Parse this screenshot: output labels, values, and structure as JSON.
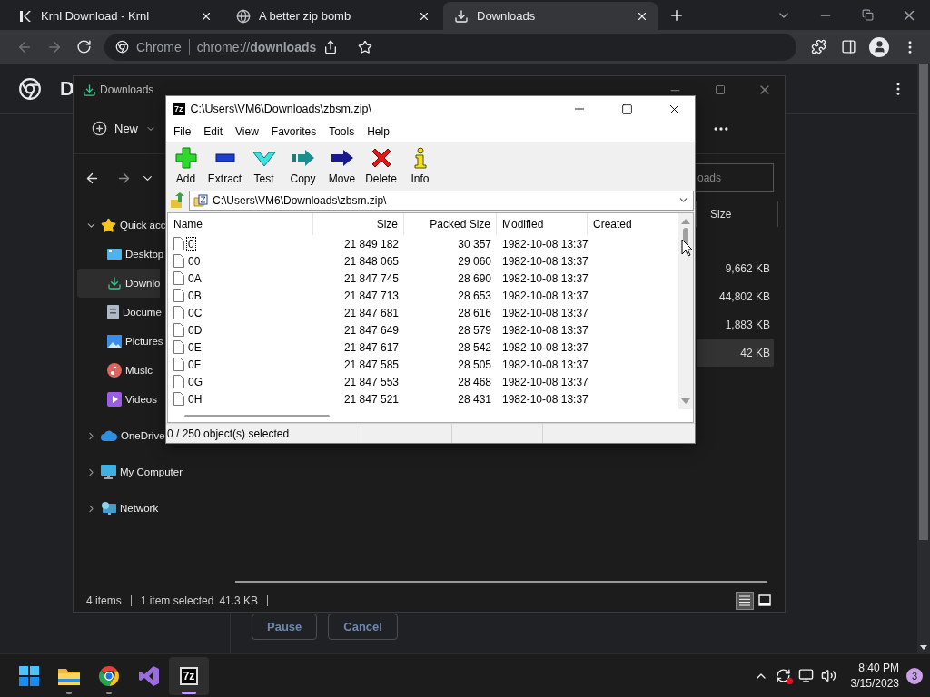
{
  "browser": {
    "tabs": [
      {
        "title": "Krnl Download - Krnl",
        "selected": false
      },
      {
        "title": "A better zip bomb",
        "selected": false
      },
      {
        "title": "Downloads",
        "selected": true
      }
    ],
    "back": {
      "disabled": true
    },
    "forward": {
      "disabled": true
    },
    "omnibox": {
      "site": "Chrome",
      "url": "chrome://**downloads**"
    },
    "page": {
      "title": "D",
      "buttons": [
        "Pause",
        "Cancel"
      ]
    }
  },
  "explorer": {
    "title": "Downloads",
    "new_button": "New",
    "search": {
      "placeholder": "oads"
    },
    "nav_tree": [
      {
        "label": "Quick acc",
        "expanded": true,
        "selected": false,
        "children": [
          {
            "label": "Desktop",
            "selected": false
          },
          {
            "label": "Downlo",
            "selected": true
          },
          {
            "label": "Docume",
            "selected": false
          },
          {
            "label": "Pictures",
            "selected": false
          },
          {
            "label": "Music",
            "selected": false
          },
          {
            "label": "Videos",
            "selected": false
          }
        ]
      },
      {
        "label": "OneDrive",
        "expanded": false,
        "selected": false
      },
      {
        "label": "My Computer",
        "expanded": false,
        "selected": false
      },
      {
        "label": "Network",
        "expanded": false,
        "selected": false
      }
    ],
    "size_column": "Size",
    "files": [
      {
        "size": "9,662 KB",
        "selected": false
      },
      {
        "size": "44,802 KB",
        "selected": false
      },
      {
        "size": "1,883 KB",
        "selected": false
      },
      {
        "size": "42 KB",
        "selected": true
      }
    ],
    "status": {
      "items": "4 items",
      "selection": "1 item selected",
      "selection_size": "41.3 KB"
    },
    "views": [
      {
        "kind": "details",
        "selected": true
      },
      {
        "kind": "tiles",
        "selected": false
      }
    ]
  },
  "sevenzip": {
    "icon_text": "7z",
    "title": "C:\\Users\\VM6\\Downloads\\zbsm.zip\\",
    "menu": [
      "File",
      "Edit",
      "View",
      "Favorites",
      "Tools",
      "Help"
    ],
    "toolbar": [
      {
        "kind": "add",
        "label": "Add"
      },
      {
        "kind": "extract",
        "label": "Extract"
      },
      {
        "kind": "test",
        "label": "Test"
      },
      {
        "kind": "copy",
        "label": "Copy"
      },
      {
        "kind": "move",
        "label": "Move"
      },
      {
        "kind": "delete",
        "label": "Delete"
      },
      {
        "kind": "info",
        "label": "Info"
      }
    ],
    "path": "C:\\Users\\VM6\\Downloads\\zbsm.zip\\",
    "columns": [
      "Name",
      "Size",
      "Packed Size",
      "Modified",
      "Created"
    ],
    "rows": [
      {
        "name": "0",
        "size": "21 849 182",
        "packed_size": "30 357",
        "modified": "1982-10-08 13:37",
        "focused": true
      },
      {
        "name": "00",
        "size": "21 848 065",
        "packed_size": "29 060",
        "modified": "1982-10-08 13:37",
        "focused": false
      },
      {
        "name": "0A",
        "size": "21 847 745",
        "packed_size": "28 690",
        "modified": "1982-10-08 13:37",
        "focused": false
      },
      {
        "name": "0B",
        "size": "21 847 713",
        "packed_size": "28 653",
        "modified": "1982-10-08 13:37",
        "focused": false
      },
      {
        "name": "0C",
        "size": "21 847 681",
        "packed_size": "28 616",
        "modified": "1982-10-08 13:37",
        "focused": false
      },
      {
        "name": "0D",
        "size": "21 847 649",
        "packed_size": "28 579",
        "modified": "1982-10-08 13:37",
        "focused": false
      },
      {
        "name": "0E",
        "size": "21 847 617",
        "packed_size": "28 542",
        "modified": "1982-10-08 13:37",
        "focused": false
      },
      {
        "name": "0F",
        "size": "21 847 585",
        "packed_size": "28 505",
        "modified": "1982-10-08 13:37",
        "focused": false
      },
      {
        "name": "0G",
        "size": "21 847 553",
        "packed_size": "28 468",
        "modified": "1982-10-08 13:37",
        "focused": false
      },
      {
        "name": "0H",
        "size": "21 847 521",
        "packed_size": "28 431",
        "modified": "1982-10-08 13:37",
        "focused": false
      }
    ],
    "status": "0 / 250 object(s) selected"
  },
  "taskbar": {
    "apps": [
      {
        "kind": "folder",
        "running": true,
        "active": false
      },
      {
        "kind": "browser",
        "running": true,
        "active": false
      },
      {
        "kind": "ide",
        "running": false,
        "active": false
      },
      {
        "kind": "archiver",
        "icon_text": "7z",
        "running": true,
        "active": true
      }
    ],
    "time": "8:40 PM",
    "date": "3/15/2023",
    "notifications": "3"
  }
}
